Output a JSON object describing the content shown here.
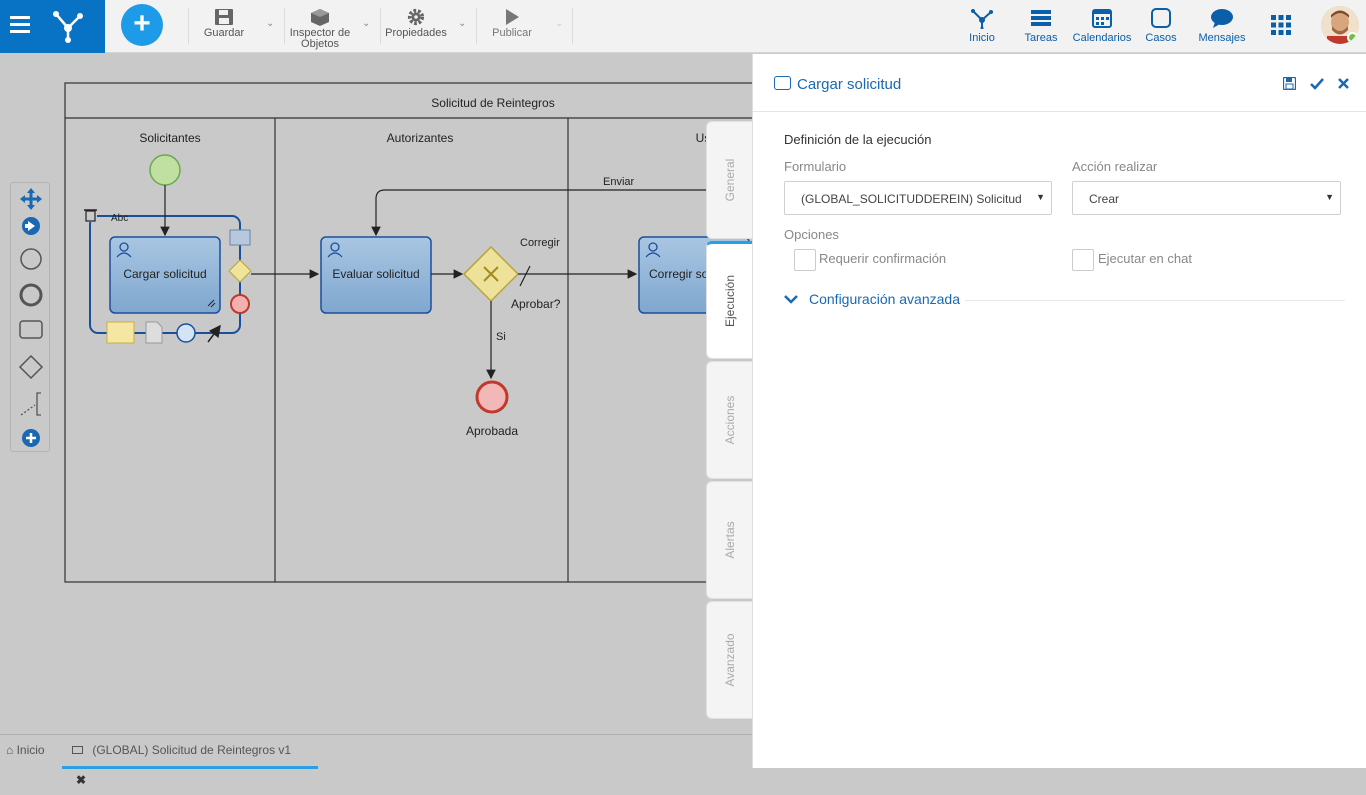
{
  "toolbar": {
    "save": "Guardar",
    "inspector_line1": "Inspector de",
    "inspector_line2": "Objetos",
    "properties": "Propiedades",
    "publish": "Publicar"
  },
  "nav": {
    "home": "Inicio",
    "tasks": "Tareas",
    "calendars": "Calendarios",
    "cases": "Casos",
    "messages": "Mensajes"
  },
  "diagram": {
    "pool_title": "Solicitud de Reintegros",
    "lanes": [
      "Solicitantes",
      "Autorizantes",
      "Us"
    ],
    "task_cargar": "Cargar solicitud",
    "task_evaluar": "Evaluar solicitud",
    "task_corregir": "Corregir so",
    "gateway_label": "Aprobar?",
    "flow_corregir": "Corregir",
    "flow_enviar": "Enviar",
    "flow_si": "Si",
    "end_label": "Aprobada",
    "edit_text": "Abc"
  },
  "panel": {
    "title": "Cargar solicitud",
    "section_title": "Definición de la ejecución",
    "form_label": "Formulario",
    "form_value": "(GLOBAL_SOLICITUDDEREIN) Solicitud",
    "action_label": "Acción realizar",
    "action_value": "Crear",
    "options_label": "Opciones",
    "opt_confirm": "Requerir confirmación",
    "opt_chat": "Ejecutar en chat",
    "advanced": "Configuración avanzada"
  },
  "vtabs": [
    "General",
    "Ejecución",
    "Acciones",
    "Alertas",
    "Avanzado"
  ],
  "bottom": {
    "home": "Inicio",
    "doc_tab": "(GLOBAL) Solicitud de Reintegros v1"
  },
  "colors": {
    "brand": "#0872c4",
    "accent": "#2b9fe6",
    "link": "#1a68b3"
  }
}
